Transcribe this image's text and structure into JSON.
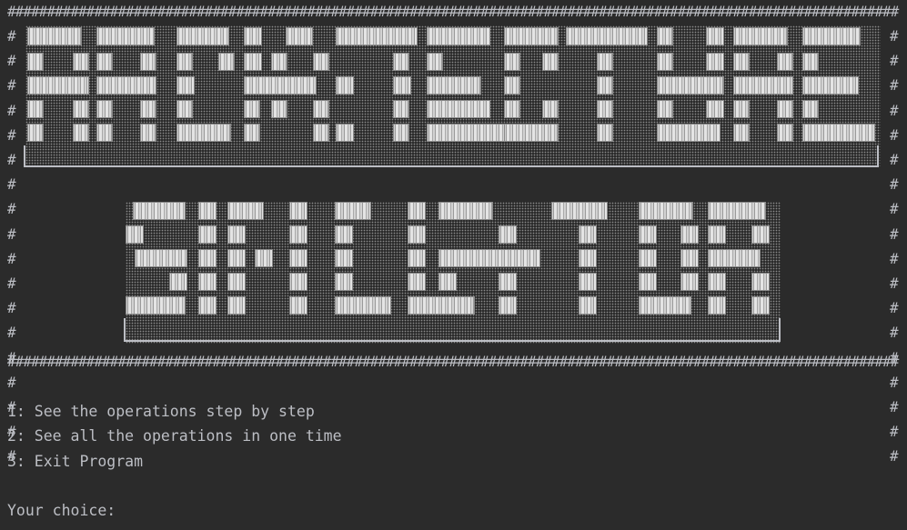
{
  "console": {
    "border_chars": "#################################################################################################################",
    "side_char": "#",
    "banner_rows": 18,
    "menu": [
      {
        "label": "1: See the operations step by step"
      },
      {
        "label": "2: See all the operations in one time"
      },
      {
        "label": "3: Exit Program"
      }
    ],
    "prompt": "Your choice: "
  },
  "colors": {
    "background": "#2b2b2b",
    "text": "#bcbec4",
    "banner_fill": "#d2d2d2"
  }
}
